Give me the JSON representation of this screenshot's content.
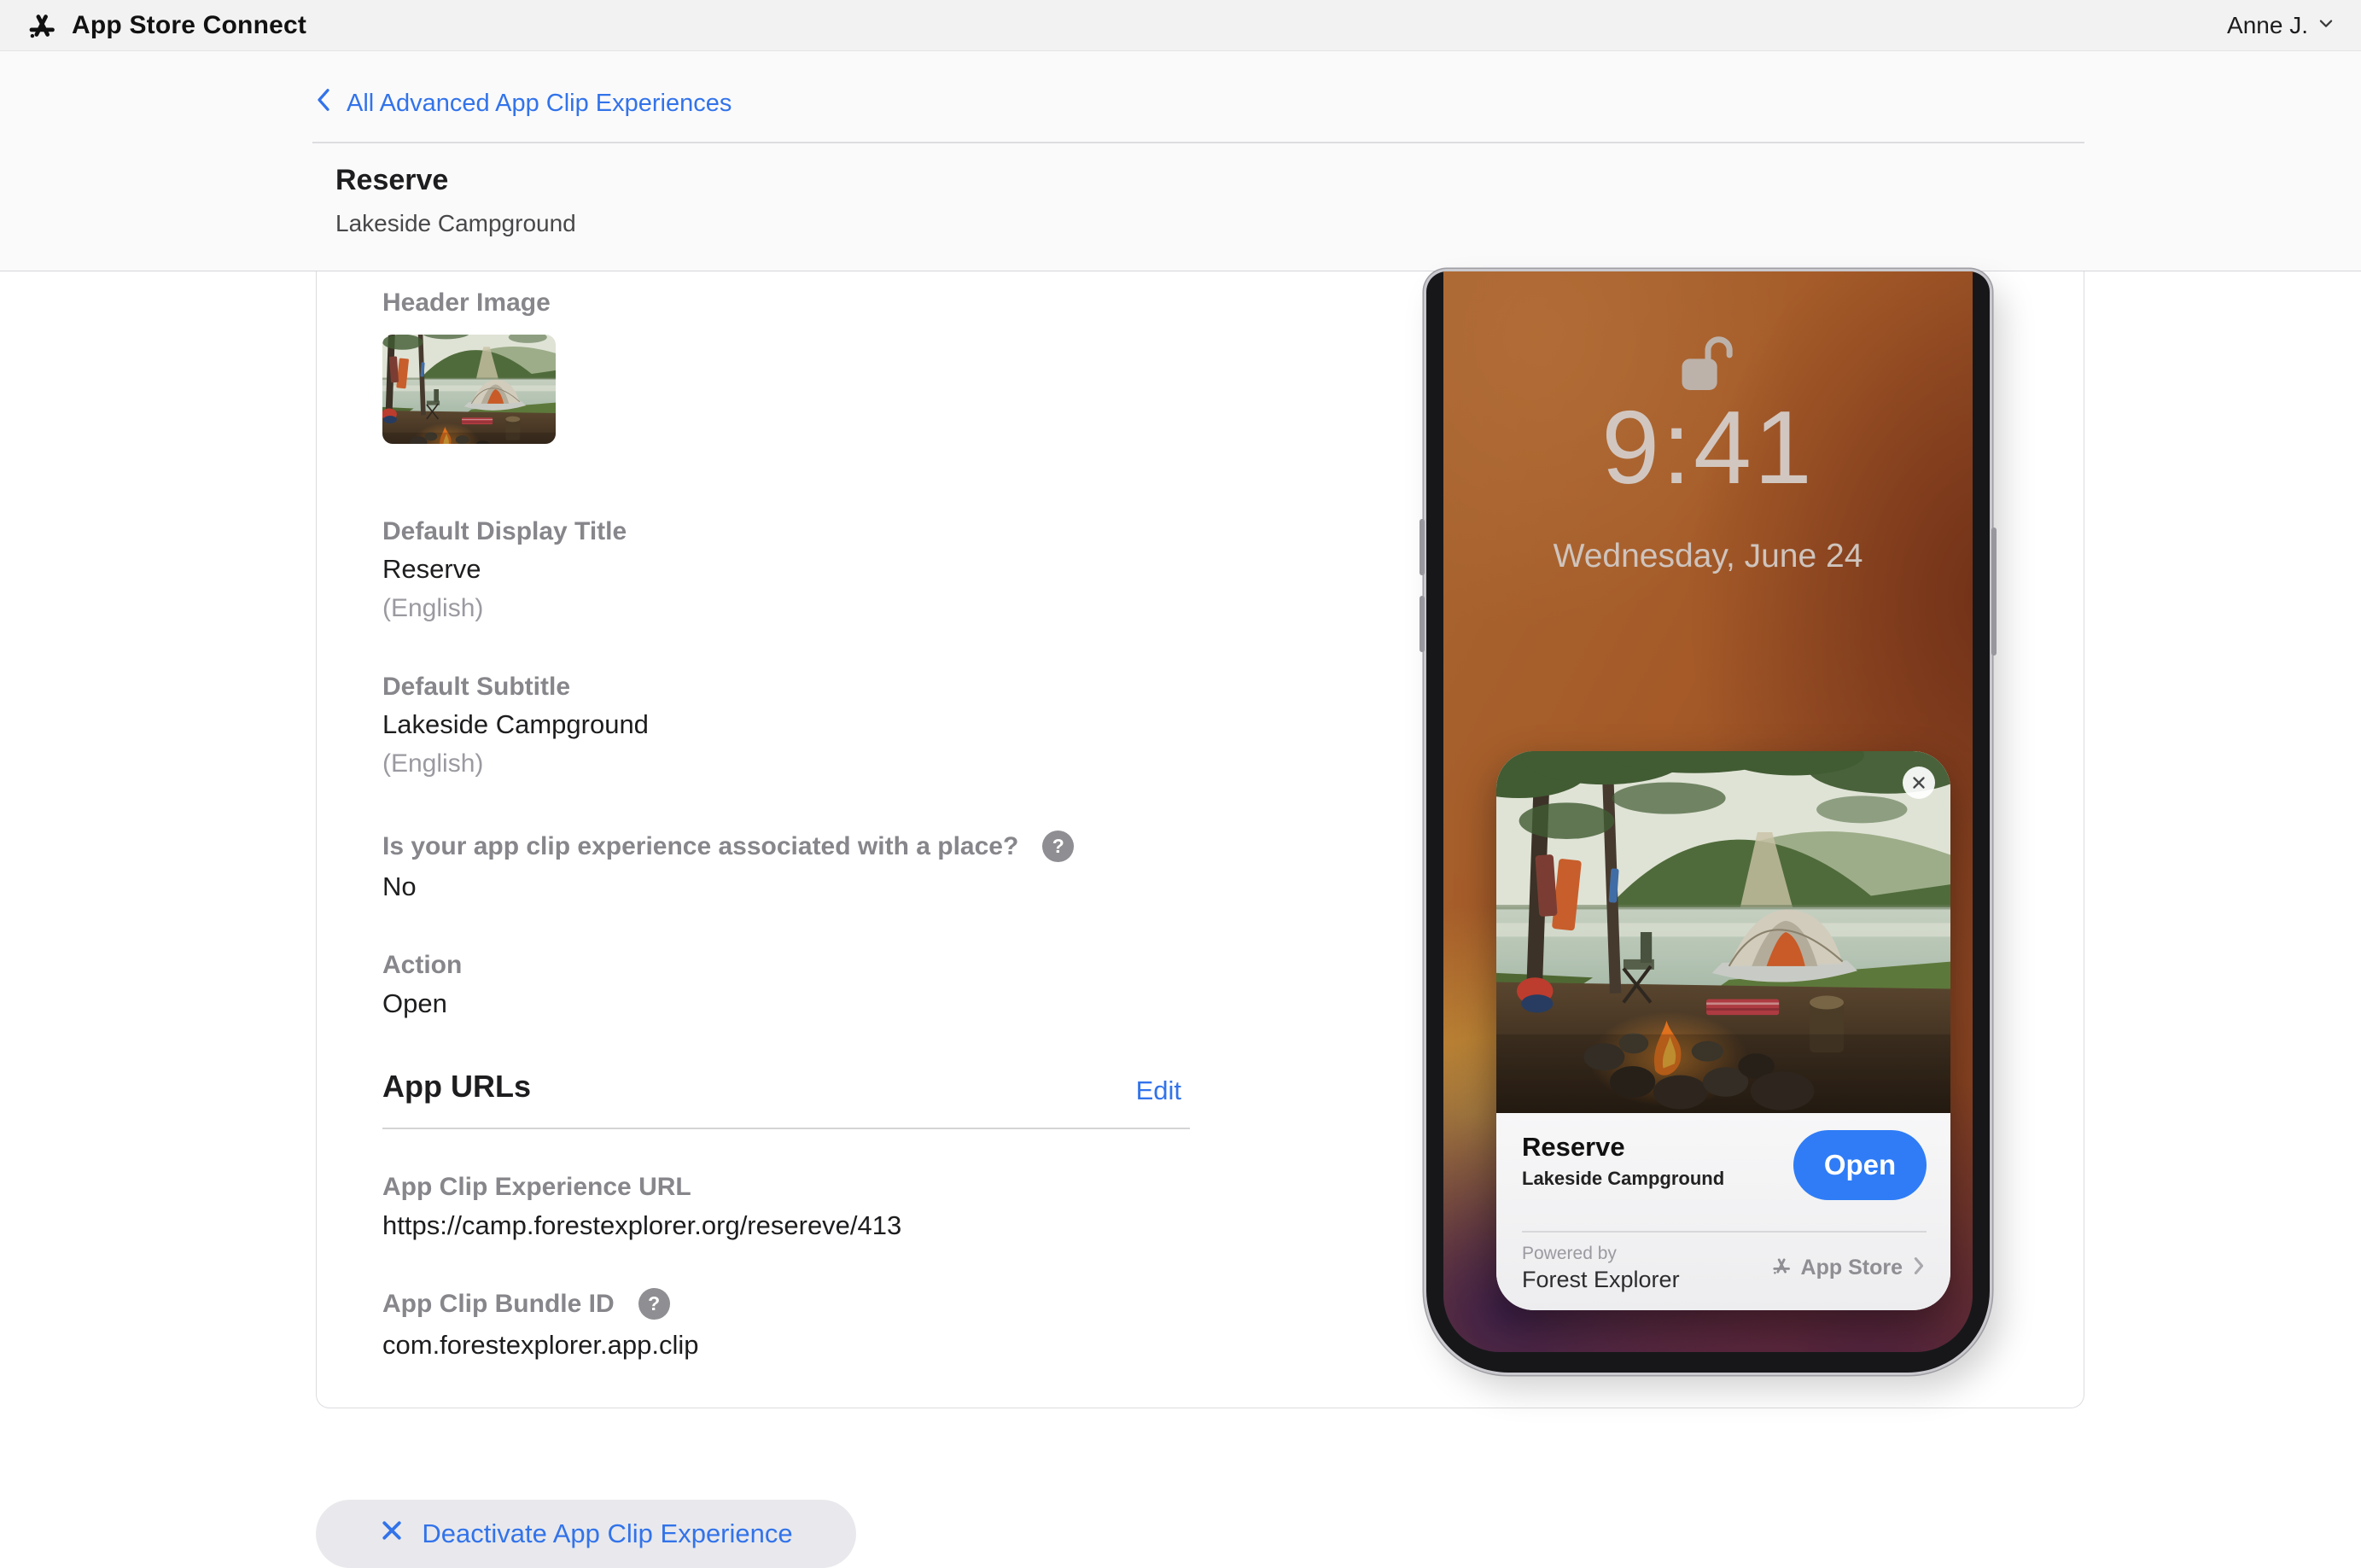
{
  "topbar": {
    "title": "App Store Connect",
    "user": "Anne J."
  },
  "breadcrumb": {
    "label": "All Advanced App Clip Experiences"
  },
  "page": {
    "title": "Reserve",
    "subtitle": "Lakeside Campground"
  },
  "card": {
    "header_image_label": "Header Image",
    "display_title": {
      "label": "Default Display Title",
      "value": "Reserve",
      "locale": "(English)"
    },
    "default_subtitle": {
      "label": "Default Subtitle",
      "value": "Lakeside Campground",
      "locale": "(English)"
    },
    "place": {
      "label": "Is your app clip experience associated with a place?",
      "value": "No"
    },
    "action": {
      "label": "Action",
      "value": "Open"
    },
    "app_urls": {
      "heading": "App URLs",
      "edit_label": "Edit",
      "experience_url": {
        "label": "App Clip Experience URL",
        "value": "https://camp.forestexplorer.org/resereve/413"
      },
      "bundle_id": {
        "label": "App Clip Bundle ID",
        "value": "com.forestexplorer.app.clip"
      }
    }
  },
  "phone": {
    "time": "9:41",
    "date": "Wednesday, June 24",
    "clip_card": {
      "title": "Reserve",
      "subtitle": "Lakeside Campground",
      "open_label": "Open",
      "powered_by": "Powered by",
      "developer": "Forest Explorer",
      "app_store_label": "App Store"
    }
  },
  "footer": {
    "deactivate_label": "Deactivate App Clip Experience"
  },
  "icons": {
    "help": "?"
  },
  "colors": {
    "link_blue": "#3273ea",
    "open_blue": "#2f7cf6",
    "label_gray": "#86868b",
    "topbar_bg": "#f2f2f2",
    "band_bg": "#fafafb",
    "deactivate_bg": "#e9e9ed"
  }
}
